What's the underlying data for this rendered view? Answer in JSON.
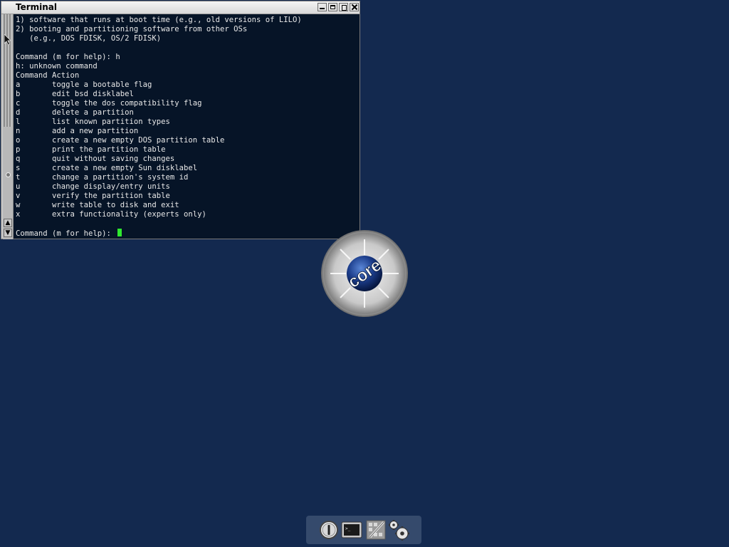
{
  "window": {
    "title": "Terminal"
  },
  "terminal": {
    "lines": [
      "1) software that runs at boot time (e.g., old versions of LILO)",
      "2) booting and partitioning software from other OSs",
      "   (e.g., DOS FDISK, OS/2 FDISK)",
      "",
      "Command (m for help): h",
      "h: unknown command",
      "Command Action",
      "a       toggle a bootable flag",
      "b       edit bsd disklabel",
      "c       toggle the dos compatibility flag",
      "d       delete a partition",
      "l       list known partition types",
      "n       add a new partition",
      "o       create a new empty DOS partition table",
      "p       print the partition table",
      "q       quit without saving changes",
      "s       create a new empty Sun disklabel",
      "t       change a partition's system id",
      "u       change display/entry units",
      "v       verify the partition table",
      "w       write table to disk and exit",
      "x       extra functionality (experts only)",
      ""
    ],
    "prompt": "Command (m for help): "
  },
  "desktop": {
    "logo_text": "core"
  },
  "dock": {
    "items": [
      {
        "icon": "power-icon"
      },
      {
        "icon": "terminal-icon"
      },
      {
        "icon": "apps-icon"
      },
      {
        "icon": "settings-gears-icon"
      }
    ]
  },
  "colors": {
    "desktop_bg": "#13294f",
    "terminal_bg": "#061427",
    "terminal_fg": "#e8e8e8",
    "cursor": "#2fe82f"
  }
}
